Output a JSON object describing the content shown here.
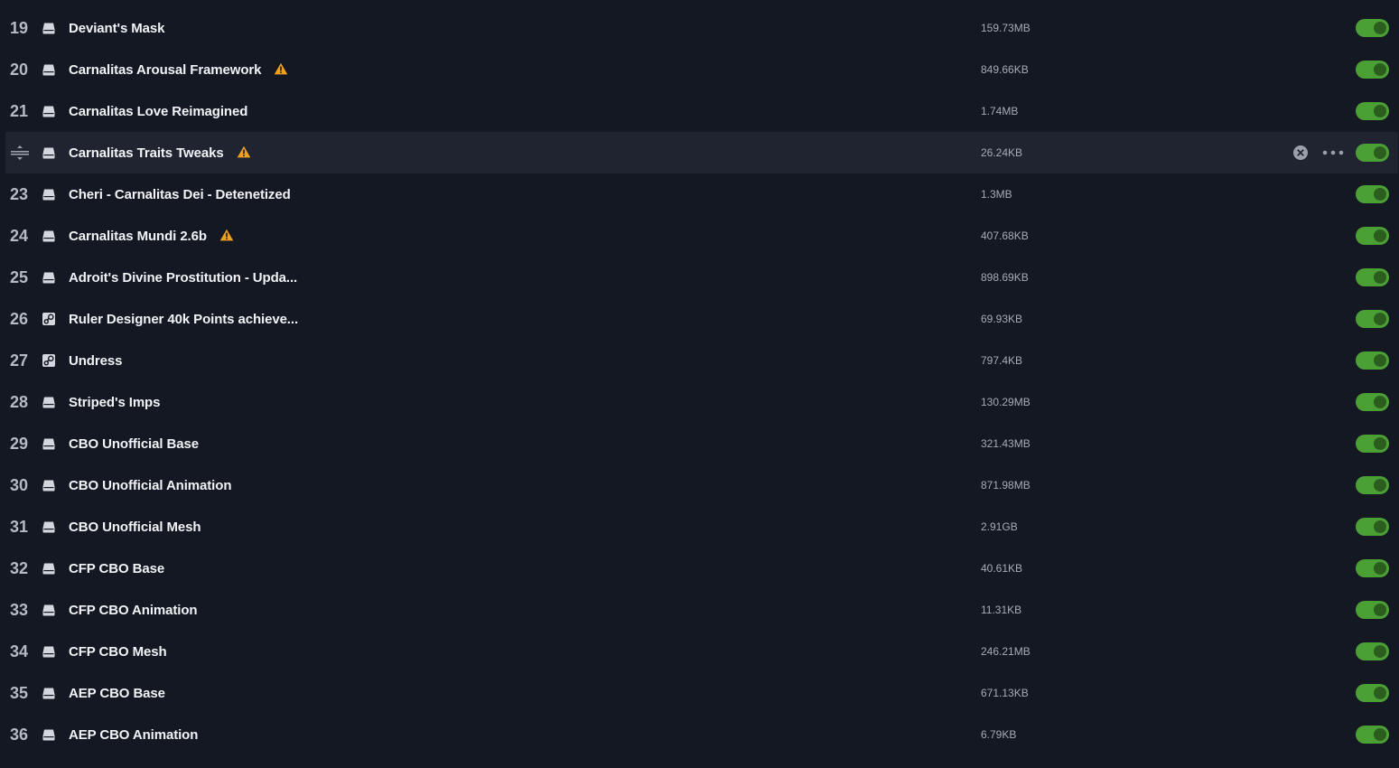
{
  "rows": [
    {
      "index": "19",
      "name": "Deviant's Mask",
      "size": "159.73MB",
      "source_icon": "drive-icon",
      "warning": false,
      "enabled": true
    },
    {
      "index": "20",
      "name": "Carnalitas Arousal Framework",
      "size": "849.66KB",
      "source_icon": "drive-icon",
      "warning": true,
      "enabled": true
    },
    {
      "index": "21",
      "name": "Carnalitas Love Reimagined",
      "size": "1.74MB",
      "source_icon": "drive-icon",
      "warning": false,
      "enabled": true
    },
    {
      "index": "",
      "name": "Carnalitas Traits Tweaks",
      "size": "26.24KB",
      "source_icon": "drive-icon",
      "warning": true,
      "enabled": true,
      "hovered": true
    },
    {
      "index": "23",
      "name": "Cheri - Carnalitas Dei - Detenetized",
      "size": "1.3MB",
      "source_icon": "drive-icon",
      "warning": false,
      "enabled": true
    },
    {
      "index": "24",
      "name": "Carnalitas Mundi 2.6b",
      "size": "407.68KB",
      "source_icon": "drive-icon",
      "warning": true,
      "enabled": true
    },
    {
      "index": "25",
      "name": "Adroit's Divine Prostitution - Upda...",
      "size": "898.69KB",
      "source_icon": "drive-icon",
      "warning": false,
      "enabled": true
    },
    {
      "index": "26",
      "name": "Ruler Designer 40k Points achieve...",
      "size": "69.93KB",
      "source_icon": "steam-icon",
      "warning": false,
      "enabled": true
    },
    {
      "index": "27",
      "name": "Undress",
      "size": "797.4KB",
      "source_icon": "steam-icon",
      "warning": false,
      "enabled": true
    },
    {
      "index": "28",
      "name": "Striped's Imps",
      "size": "130.29MB",
      "source_icon": "drive-icon",
      "warning": false,
      "enabled": true
    },
    {
      "index": "29",
      "name": "CBO Unofficial Base",
      "size": "321.43MB",
      "source_icon": "drive-icon",
      "warning": false,
      "enabled": true
    },
    {
      "index": "30",
      "name": "CBO Unofficial Animation",
      "size": "871.98MB",
      "source_icon": "drive-icon",
      "warning": false,
      "enabled": true
    },
    {
      "index": "31",
      "name": "CBO Unofficial Mesh",
      "size": "2.91GB",
      "source_icon": "drive-icon",
      "warning": false,
      "enabled": true
    },
    {
      "index": "32",
      "name": "CFP CBO Base",
      "size": "40.61KB",
      "source_icon": "drive-icon",
      "warning": false,
      "enabled": true
    },
    {
      "index": "33",
      "name": "CFP CBO Animation",
      "size": "11.31KB",
      "source_icon": "drive-icon",
      "warning": false,
      "enabled": true
    },
    {
      "index": "34",
      "name": "CFP CBO Mesh",
      "size": "246.21MB",
      "source_icon": "drive-icon",
      "warning": false,
      "enabled": true
    },
    {
      "index": "35",
      "name": "AEP CBO Base",
      "size": "671.13KB",
      "source_icon": "drive-icon",
      "warning": false,
      "enabled": true
    },
    {
      "index": "36",
      "name": "AEP CBO Animation",
      "size": "6.79KB",
      "source_icon": "drive-icon",
      "warning": false,
      "enabled": true
    }
  ],
  "colors": {
    "background": "#141823",
    "hover_row": "#1f2430",
    "toggle_on": "#4a9f35",
    "warning": "#f0a020"
  }
}
